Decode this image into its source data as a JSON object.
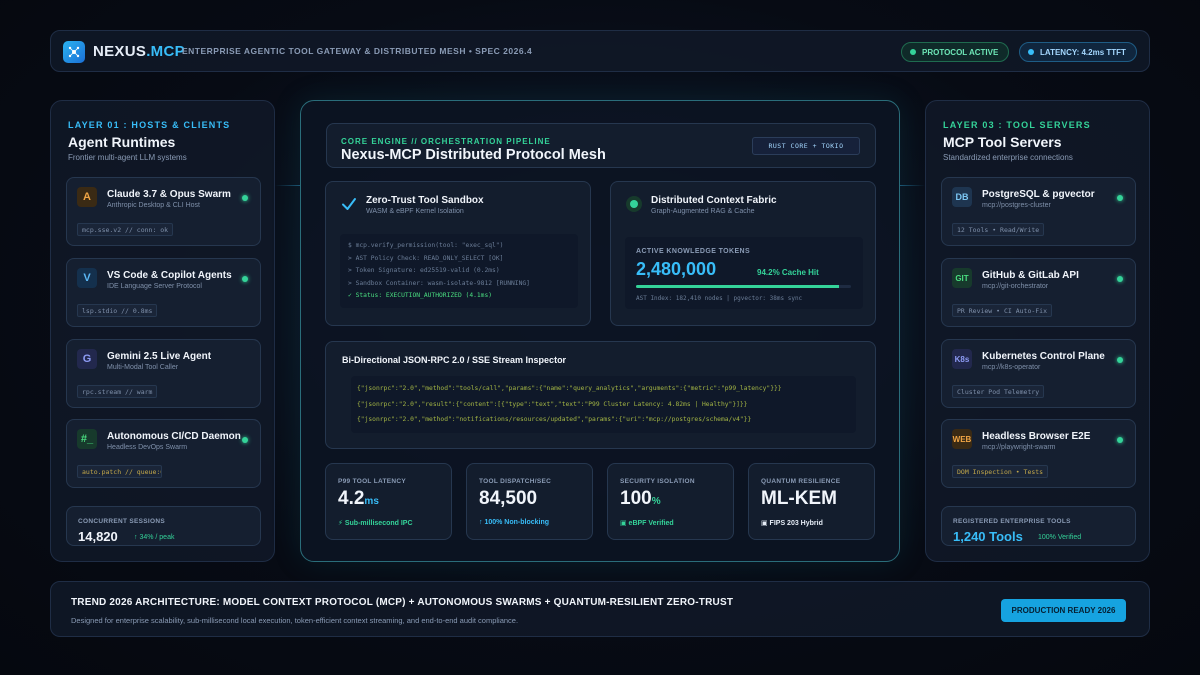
{
  "header": {
    "brand_main": "NEXUS",
    "brand_accent": ".MCP",
    "subtitle": "ENTERPRISE AGENTIC TOOL GATEWAY & DISTRIBUTED MESH • SPEC 2026.4",
    "status_protocol": "PROTOCOL ACTIVE",
    "status_latency": "LATENCY: 4.2ms TTFT"
  },
  "left": {
    "layer_tag": "LAYER 01 : HOSTS & CLIENTS",
    "title": "Agent Runtimes",
    "subtitle": "Frontier multi-agent LLM systems",
    "cards": [
      {
        "icon": "A",
        "title": "Claude 3.7 & Opus Swarm",
        "sub": "Anthropic Desktop & CLI Host",
        "chip": "mcp.sse.v2 // conn: ok"
      },
      {
        "icon": "V",
        "title": "VS Code & Copilot Agents",
        "sub": "IDE Language Server Protocol",
        "chip": "lsp.stdio // 0.8ms"
      },
      {
        "icon": "G",
        "title": "Gemini 2.5 Live Agent",
        "sub": "Multi-Modal Tool Caller",
        "chip": "rpc.stream // warm"
      },
      {
        "icon": "#_",
        "title": "Autonomous CI/CD Daemon",
        "sub": "Headless DevOps Swarm",
        "chip": "auto.patch // queue:0"
      }
    ],
    "sessions_label": "CONCURRENT SESSIONS",
    "sessions_value": "14,820",
    "sessions_delta": "↑ 34% / peak"
  },
  "center": {
    "engine_tag": "CORE ENGINE // ORCHESTRATION PIPELINE",
    "engine_title": "Nexus-MCP Distributed Protocol Mesh",
    "engine_badge": "RUST CORE + TOKIO",
    "sandbox": {
      "title": "Zero-Trust Tool Sandbox",
      "sub": "WASM & eBPF Kernel Isolation",
      "lines": [
        "$ mcp.verify_permission(tool: \"exec_sql\")",
        "> AST Policy Check: READ_ONLY_SELECT [OK]",
        "> Token Signature: ed25519-valid (0.2ms)",
        "> Sandbox Container: wasm-isolate-9812 [RUNNING]",
        "✓ Status: EXECUTION_AUTHORIZED (4.1ms)"
      ]
    },
    "fabric": {
      "title": "Distributed Context Fabric",
      "sub": "Graph-Augmented RAG & Cache",
      "tokens_label": "ACTIVE KNOWLEDGE TOKENS",
      "tokens_value": "2,480,000",
      "cache_hit": "94.2% Cache Hit",
      "cache_fraction": 0.942,
      "meta": "AST Index: 182,410 nodes | pgvector: 38ms sync"
    },
    "rpc": {
      "title": "Bi-Directional JSON-RPC 2.0 / SSE Stream Inspector",
      "lines": [
        "{\"jsonrpc\":\"2.0\",\"method\":\"tools/call\",\"params\":{\"name\":\"query_analytics\",\"arguments\":{\"metric\":\"p99_latency\"}}}",
        "{\"jsonrpc\":\"2.0\",\"result\":{\"content\":[{\"type\":\"text\",\"text\":\"P99 Cluster Latency: 4.82ms | Healthy\"}]}}",
        "{\"jsonrpc\":\"2.0\",\"method\":\"notifications/resources/updated\",\"params\":{\"uri\":\"mcp://postgres/schema/v4\"}}"
      ]
    },
    "metrics": [
      {
        "label": "P99 TOOL LATENCY",
        "value": "4.2",
        "unit": "ms",
        "note": "⚡ Sub-millisecond IPC",
        "note_color": "#34d399"
      },
      {
        "label": "TOOL DISPATCH/SEC",
        "value": "84,500",
        "unit": "",
        "note": "↑ 100% Non-blocking",
        "note_color": "#38bdf8"
      },
      {
        "label": "SECURITY ISOLATION",
        "value": "100",
        "unit": "%",
        "note": "▣ eBPF Verified",
        "note_color": "#34d399"
      },
      {
        "label": "QUANTUM RESILIENCE",
        "value": "ML-KEM",
        "unit": "",
        "note": "▣ FIPS 203 Hybrid",
        "note_color": "#e6edf7"
      }
    ]
  },
  "right": {
    "layer_tag": "LAYER 03 : TOOL SERVERS",
    "title": "MCP Tool Servers",
    "subtitle": "Standardized enterprise connections",
    "cards": [
      {
        "icon": "DB",
        "title": "PostgreSQL & pgvector",
        "sub": "mcp://postgres-cluster",
        "chip": "12 Tools • Read/Write"
      },
      {
        "icon": "GIT",
        "title": "GitHub & GitLab API",
        "sub": "mcp://git-orchestrator",
        "chip": "PR Review • CI Auto-Fix"
      },
      {
        "icon": "K8s",
        "title": "Kubernetes Control Plane",
        "sub": "mcp://k8s-operator",
        "chip": "Cluster Pod Telemetry"
      },
      {
        "icon": "WEB",
        "title": "Headless Browser E2E",
        "sub": "mcp://playwright-swarm",
        "chip": "DOM Inspection • Tests"
      }
    ],
    "tools_label": "REGISTERED ENTERPRISE TOOLS",
    "tools_value": "1,240 Tools",
    "tools_extra": "100% Verified"
  },
  "footer": {
    "title": "TREND 2026 ARCHITECTURE: MODEL CONTEXT PROTOCOL (MCP) + AUTONOMOUS SWARMS + QUANTUM-RESILIENT ZERO-TRUST",
    "sub": "Designed for enterprise scalability, sub-millisecond local execution, token-efficient context streaming, and end-to-end audit compliance.",
    "button": "PRODUCTION READY 2026"
  },
  "colors": {
    "accent_blue": "#38bdf8",
    "accent_green": "#34d399",
    "background": "#070b14"
  }
}
